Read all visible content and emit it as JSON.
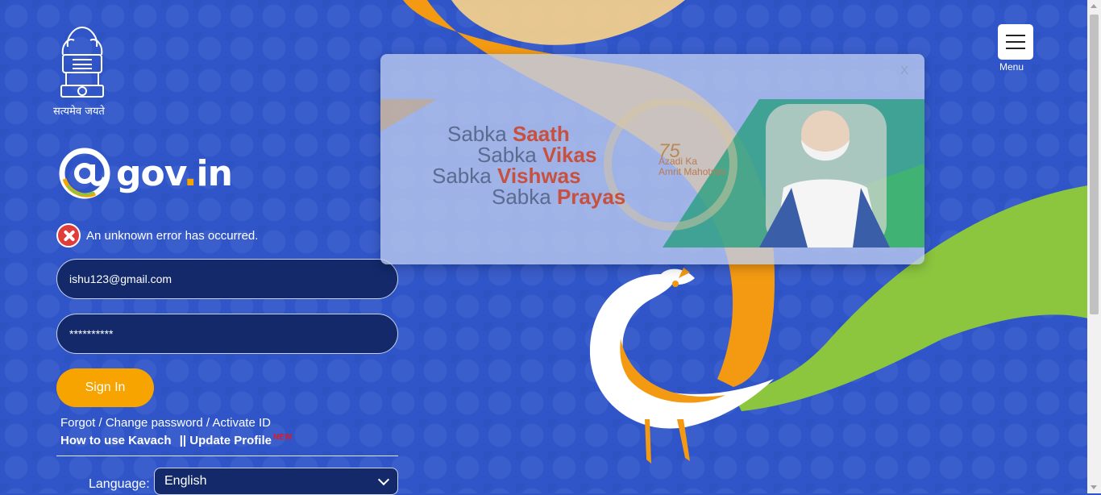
{
  "header": {
    "emblem_caption": "सत्यमेव जयते",
    "logo_text": "gov",
    "logo_dot": ".",
    "logo_suffix": "in",
    "menu_label": "Menu"
  },
  "login": {
    "error_message": "An unknown error has occurred.",
    "email_value": "ishu123@gmail.com",
    "password_value": "**********",
    "signin_label": "Sign In",
    "forgot_link": "Forgot / Change password / Activate ID",
    "kavach_link": "How to use Kavach",
    "separator": "||",
    "update_profile_link": "Update Profile",
    "new_badge": "NEW",
    "language_label": "Language:",
    "language_selected": "English"
  },
  "popup": {
    "close_label": "X",
    "slogan": [
      {
        "prefix": "Sabka ",
        "word": "Saath"
      },
      {
        "prefix": "Sabka ",
        "word": "Vikas"
      },
      {
        "prefix": "Sabka ",
        "word": "Vishwas"
      },
      {
        "prefix": "Sabka ",
        "word": "Prayas"
      }
    ],
    "badge_number": "75",
    "badge_line1": "Azadi",
    "badge_ka": "Ka",
    "badge_line2": "Amrit",
    "badge_line3": "Mahotsav"
  },
  "colors": {
    "background": "#2f55c9",
    "accent_orange": "#f7a400",
    "accent_green": "#8cc63f",
    "error_red": "#e23b3b",
    "field_bg": "#13296a"
  }
}
